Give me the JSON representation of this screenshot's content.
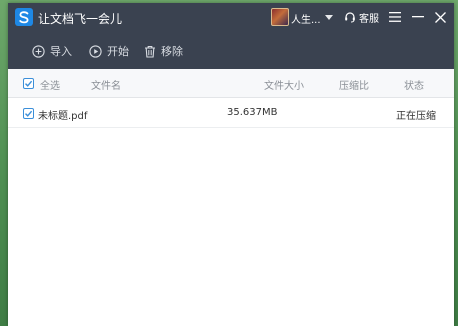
{
  "window": {
    "title": "让文档飞一会儿",
    "username": "人生...",
    "service_label": "客服"
  },
  "toolbar": {
    "import_label": "导入",
    "start_label": "开始",
    "remove_label": "移除"
  },
  "table": {
    "headers": {
      "select_all": "全选",
      "file_name": "文件名",
      "file_size": "文件大小",
      "ratio": "压缩比",
      "status": "状态"
    },
    "rows": [
      {
        "checked": true,
        "file_name": "未标题.pdf",
        "file_size": "35.637MB",
        "ratio": "",
        "status": "正在压缩"
      }
    ]
  },
  "colors": {
    "titlebar": "#3a4250",
    "accent": "#1e88e5",
    "checkbox": "#3b8fd9"
  },
  "icons": [
    "app-logo-icon",
    "caret-down-icon",
    "headset-icon",
    "menu-icon",
    "minimize-icon",
    "close-icon",
    "plus-circle-icon",
    "play-circle-icon",
    "trash-icon",
    "checkbox-checked-icon"
  ]
}
